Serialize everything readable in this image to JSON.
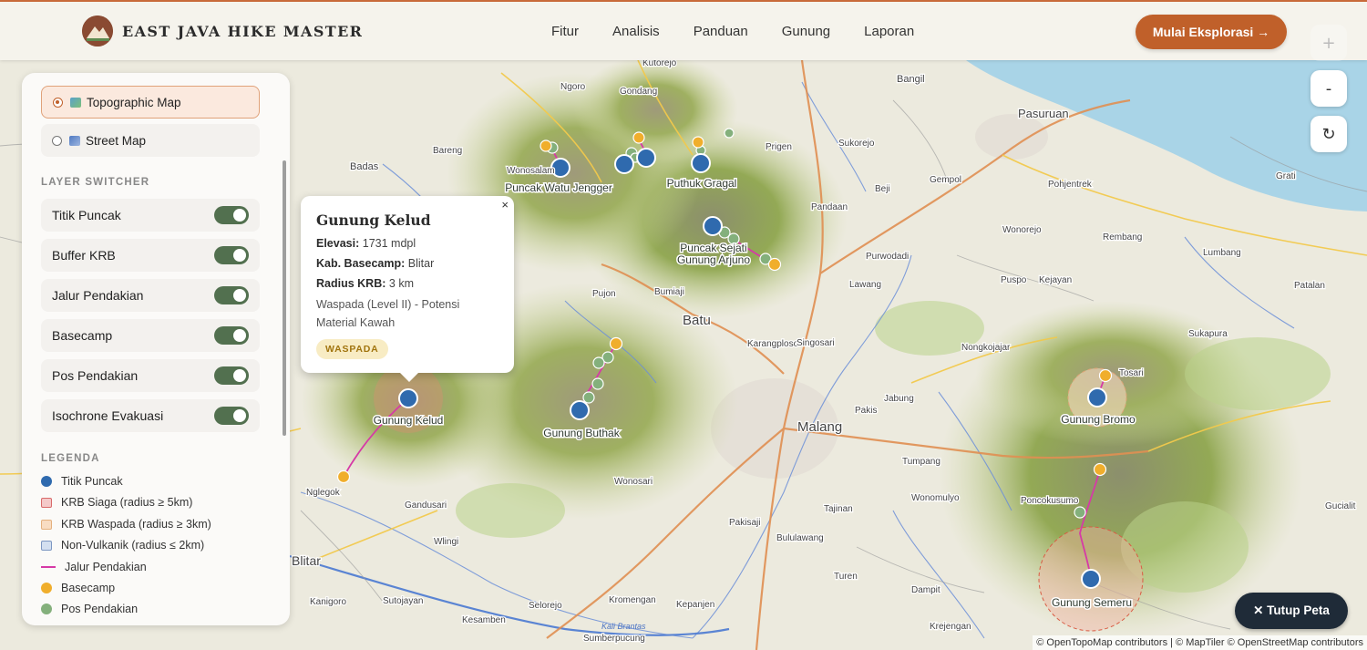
{
  "header": {
    "brand": "EAST JAVA HIKE MASTER",
    "nav": [
      "Fitur",
      "Analisis",
      "Panduan",
      "Gunung",
      "Laporan"
    ],
    "cta": "Mulai Eksplorasi →"
  },
  "controls": {
    "zoom_in": "+",
    "zoom_out": "-",
    "reset": "↻"
  },
  "sidebar": {
    "basemaps": [
      {
        "label": "Topographic Map",
        "selected": true
      },
      {
        "label": "Street Map",
        "selected": false
      }
    ],
    "layer_switcher_title": "LAYER SWITCHER",
    "layers": [
      {
        "label": "Titik Puncak",
        "on": true
      },
      {
        "label": "Buffer KRB",
        "on": true
      },
      {
        "label": "Jalur Pendakian",
        "on": true
      },
      {
        "label": "Basecamp",
        "on": true
      },
      {
        "label": "Pos Pendakian",
        "on": true
      },
      {
        "label": "Isochrone Evakuasi",
        "on": true
      }
    ],
    "legend_title": "LEGENDA",
    "legend": [
      {
        "label": "Titik Puncak",
        "type": "dot",
        "color": "#2f6aae"
      },
      {
        "label": "KRB Siaga (radius ≥ 5km)",
        "type": "square",
        "color": "#f4c9c9",
        "border": "#d96a6a"
      },
      {
        "label": "KRB Waspada (radius ≥ 3km)",
        "type": "square",
        "color": "#f8dcc2",
        "border": "#e4b07e"
      },
      {
        "label": "Non-Vulkanik (radius ≤ 2km)",
        "type": "square",
        "color": "#d3dff0",
        "border": "#7d97c2"
      },
      {
        "label": "Jalur Pendakian",
        "type": "line",
        "color": "#d63aa6"
      },
      {
        "label": "Basecamp",
        "type": "dot",
        "color": "#f0ae2c"
      },
      {
        "label": "Pos Pendakian",
        "type": "dot",
        "color": "#84b07c"
      }
    ]
  },
  "popup": {
    "title": "Gunung Kelud",
    "elevation_label": "Elevasi:",
    "elevation_value": "1731 mdpl",
    "basecamp_label": "Kab. Basecamp:",
    "basecamp_value": "Blitar",
    "radius_label": "Radius KRB:",
    "radius_value": "3 km",
    "description": "Waspada (Level II) - Potensi Material Kawah",
    "badge": "WASPADA",
    "close": "×"
  },
  "close_map": "✕ Tutup Peta",
  "attribution": "© OpenTopoMap contributors | © MapTiler © OpenStreetMap contributors",
  "map": {
    "peaks": [
      {
        "name": "Gunung Kelud"
      },
      {
        "name": "Gunung Buthak"
      },
      {
        "name": "Puncak Sejati\nGunung Arjuno"
      },
      {
        "name": "Puncak Watu Jengger"
      },
      {
        "name": "Puthuk Gragal"
      },
      {
        "name": "Gunung Bromo"
      },
      {
        "name": "Gunung Semeru"
      }
    ],
    "places": [
      "Batu",
      "Malang",
      "Pasuruan",
      "Bangil",
      "Badas",
      "Pujon",
      "Bumiaji",
      "Karangploso",
      "Singosari",
      "Lawang",
      "Purwodadi",
      "Nongkojajar",
      "Tumpang",
      "Poncokusumo",
      "Jabung",
      "Pakis",
      "Tajinan",
      "Bululawang",
      "Turen",
      "Dampit",
      "Kepanjen",
      "Wonosari",
      "Gandusari",
      "Wlingi",
      "Kanigoro",
      "Sutojayan",
      "Selorejo",
      "Kesamben",
      "Sumberpucung",
      "Kromengan",
      "Pakisaji",
      "Wonomulyo",
      "Nglegok",
      "Blitar",
      "Krejengan",
      "Sukapura",
      "Lumbang",
      "Tosari",
      "Grati",
      "Rembang",
      "Wonorejo",
      "Kejayan",
      "Gempol",
      "Beji",
      "Pohjentrek",
      "Puspo",
      "Pandaan",
      "Gondang",
      "Gucialit",
      "Patalan",
      "Ngoro",
      "Wonosalam",
      "Bareng",
      "Kutorejo",
      "Prigen",
      "Sukorejo"
    ],
    "river_label": "Kali Brantas"
  }
}
